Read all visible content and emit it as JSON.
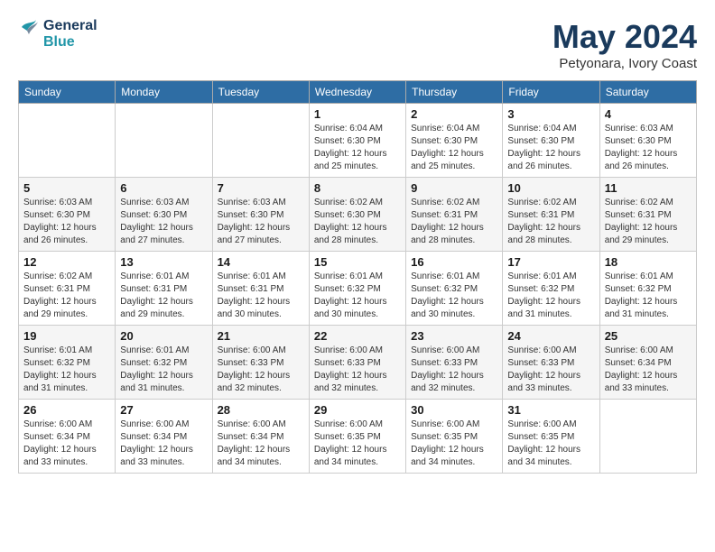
{
  "header": {
    "logo_line1": "General",
    "logo_line2": "Blue",
    "month_title": "May 2024",
    "location": "Petyonara, Ivory Coast"
  },
  "days_of_week": [
    "Sunday",
    "Monday",
    "Tuesday",
    "Wednesday",
    "Thursday",
    "Friday",
    "Saturday"
  ],
  "weeks": [
    [
      {
        "day": "",
        "info": ""
      },
      {
        "day": "",
        "info": ""
      },
      {
        "day": "",
        "info": ""
      },
      {
        "day": "1",
        "info": "Sunrise: 6:04 AM\nSunset: 6:30 PM\nDaylight: 12 hours\nand 25 minutes."
      },
      {
        "day": "2",
        "info": "Sunrise: 6:04 AM\nSunset: 6:30 PM\nDaylight: 12 hours\nand 25 minutes."
      },
      {
        "day": "3",
        "info": "Sunrise: 6:04 AM\nSunset: 6:30 PM\nDaylight: 12 hours\nand 26 minutes."
      },
      {
        "day": "4",
        "info": "Sunrise: 6:03 AM\nSunset: 6:30 PM\nDaylight: 12 hours\nand 26 minutes."
      }
    ],
    [
      {
        "day": "5",
        "info": "Sunrise: 6:03 AM\nSunset: 6:30 PM\nDaylight: 12 hours\nand 26 minutes."
      },
      {
        "day": "6",
        "info": "Sunrise: 6:03 AM\nSunset: 6:30 PM\nDaylight: 12 hours\nand 27 minutes."
      },
      {
        "day": "7",
        "info": "Sunrise: 6:03 AM\nSunset: 6:30 PM\nDaylight: 12 hours\nand 27 minutes."
      },
      {
        "day": "8",
        "info": "Sunrise: 6:02 AM\nSunset: 6:30 PM\nDaylight: 12 hours\nand 28 minutes."
      },
      {
        "day": "9",
        "info": "Sunrise: 6:02 AM\nSunset: 6:31 PM\nDaylight: 12 hours\nand 28 minutes."
      },
      {
        "day": "10",
        "info": "Sunrise: 6:02 AM\nSunset: 6:31 PM\nDaylight: 12 hours\nand 28 minutes."
      },
      {
        "day": "11",
        "info": "Sunrise: 6:02 AM\nSunset: 6:31 PM\nDaylight: 12 hours\nand 29 minutes."
      }
    ],
    [
      {
        "day": "12",
        "info": "Sunrise: 6:02 AM\nSunset: 6:31 PM\nDaylight: 12 hours\nand 29 minutes."
      },
      {
        "day": "13",
        "info": "Sunrise: 6:01 AM\nSunset: 6:31 PM\nDaylight: 12 hours\nand 29 minutes."
      },
      {
        "day": "14",
        "info": "Sunrise: 6:01 AM\nSunset: 6:31 PM\nDaylight: 12 hours\nand 30 minutes."
      },
      {
        "day": "15",
        "info": "Sunrise: 6:01 AM\nSunset: 6:32 PM\nDaylight: 12 hours\nand 30 minutes."
      },
      {
        "day": "16",
        "info": "Sunrise: 6:01 AM\nSunset: 6:32 PM\nDaylight: 12 hours\nand 30 minutes."
      },
      {
        "day": "17",
        "info": "Sunrise: 6:01 AM\nSunset: 6:32 PM\nDaylight: 12 hours\nand 31 minutes."
      },
      {
        "day": "18",
        "info": "Sunrise: 6:01 AM\nSunset: 6:32 PM\nDaylight: 12 hours\nand 31 minutes."
      }
    ],
    [
      {
        "day": "19",
        "info": "Sunrise: 6:01 AM\nSunset: 6:32 PM\nDaylight: 12 hours\nand 31 minutes."
      },
      {
        "day": "20",
        "info": "Sunrise: 6:01 AM\nSunset: 6:32 PM\nDaylight: 12 hours\nand 31 minutes."
      },
      {
        "day": "21",
        "info": "Sunrise: 6:00 AM\nSunset: 6:33 PM\nDaylight: 12 hours\nand 32 minutes."
      },
      {
        "day": "22",
        "info": "Sunrise: 6:00 AM\nSunset: 6:33 PM\nDaylight: 12 hours\nand 32 minutes."
      },
      {
        "day": "23",
        "info": "Sunrise: 6:00 AM\nSunset: 6:33 PM\nDaylight: 12 hours\nand 32 minutes."
      },
      {
        "day": "24",
        "info": "Sunrise: 6:00 AM\nSunset: 6:33 PM\nDaylight: 12 hours\nand 33 minutes."
      },
      {
        "day": "25",
        "info": "Sunrise: 6:00 AM\nSunset: 6:34 PM\nDaylight: 12 hours\nand 33 minutes."
      }
    ],
    [
      {
        "day": "26",
        "info": "Sunrise: 6:00 AM\nSunset: 6:34 PM\nDaylight: 12 hours\nand 33 minutes."
      },
      {
        "day": "27",
        "info": "Sunrise: 6:00 AM\nSunset: 6:34 PM\nDaylight: 12 hours\nand 33 minutes."
      },
      {
        "day": "28",
        "info": "Sunrise: 6:00 AM\nSunset: 6:34 PM\nDaylight: 12 hours\nand 34 minutes."
      },
      {
        "day": "29",
        "info": "Sunrise: 6:00 AM\nSunset: 6:35 PM\nDaylight: 12 hours\nand 34 minutes."
      },
      {
        "day": "30",
        "info": "Sunrise: 6:00 AM\nSunset: 6:35 PM\nDaylight: 12 hours\nand 34 minutes."
      },
      {
        "day": "31",
        "info": "Sunrise: 6:00 AM\nSunset: 6:35 PM\nDaylight: 12 hours\nand 34 minutes."
      },
      {
        "day": "",
        "info": ""
      }
    ]
  ]
}
